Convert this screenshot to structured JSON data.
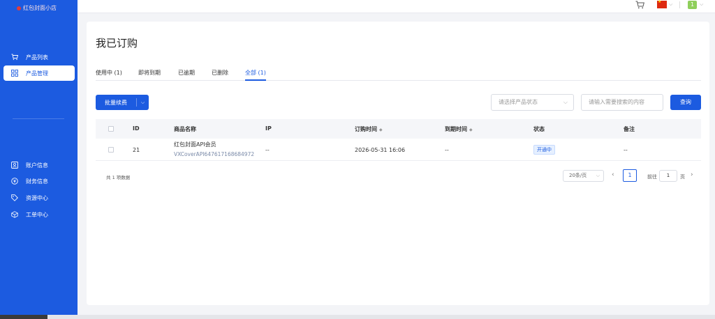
{
  "sidebar": {
    "logo": "红包封面小店",
    "items": [
      {
        "label": "产品列表",
        "icon": "cart-icon"
      },
      {
        "label": "产品管理",
        "icon": "grid-icon"
      },
      {
        "label": "账户信息",
        "icon": "user-card-icon"
      },
      {
        "label": "财务信息",
        "icon": "money-icon"
      },
      {
        "label": "资源中心",
        "icon": "tag-icon"
      },
      {
        "label": "工单中心",
        "icon": "box-icon"
      }
    ],
    "active_index": 1
  },
  "header": {
    "avatar_label": "1",
    "language_flag": "cn-flag-icon"
  },
  "page": {
    "title": "我已订购",
    "tabs": [
      "使用中 (1)",
      "即将到期",
      "已逾期",
      "已删除",
      "全部 (1)"
    ],
    "active_tab": 4,
    "batch_button": "批量续费",
    "status_placeholder": "请选择产品状态",
    "search_placeholder": "请输入需要搜索的内容",
    "query_button": "查询"
  },
  "table": {
    "columns": [
      "ID",
      "商品名称",
      "IP",
      "订购时间",
      "到期时间",
      "状态",
      "备注"
    ],
    "rows": [
      {
        "id": "21",
        "name": "红包封面API会员",
        "code": "VXCoverAPI647617168684972",
        "ip": "--",
        "order_time": "2026-05-31 16:06",
        "expire_time": "--",
        "status": "开通中",
        "remark": "--"
      }
    ]
  },
  "pagination": {
    "total": "共 1 项数据",
    "page_size": "20条/页",
    "current_page": "1",
    "goto_label": "前往",
    "goto_value": "1",
    "page_unit": "页"
  },
  "colors": {
    "primary": "#1c5be0",
    "status_badge_bg": "#e6f0ff"
  }
}
